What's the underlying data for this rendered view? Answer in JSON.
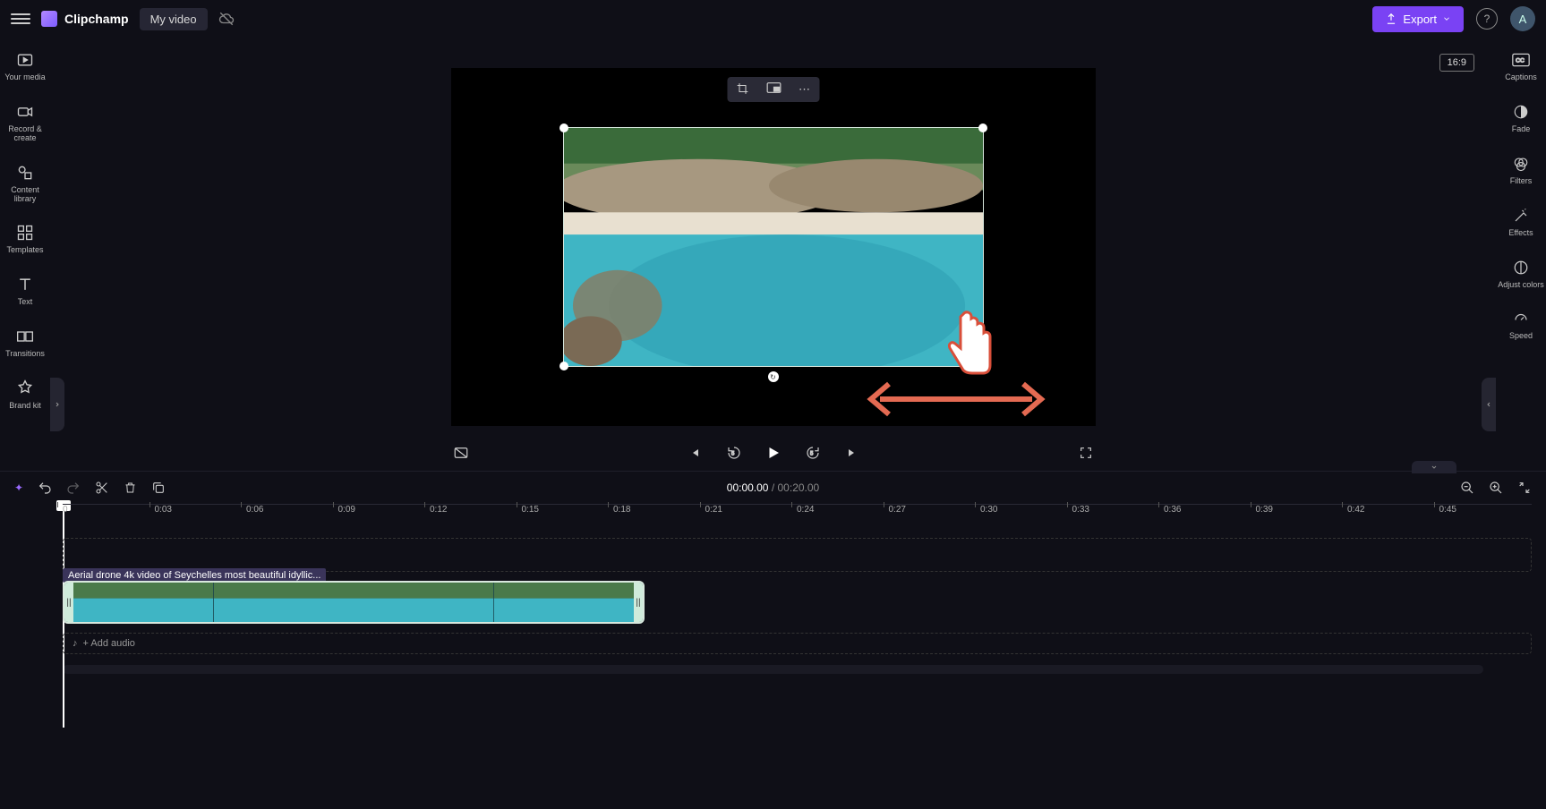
{
  "header": {
    "brand": "Clipchamp",
    "project_title": "My video",
    "export_label": "Export",
    "avatar_initial": "A"
  },
  "left_rail": [
    {
      "label": "Your media",
      "icon": "media"
    },
    {
      "label": "Record & create",
      "icon": "camera"
    },
    {
      "label": "Content library",
      "icon": "shapes"
    },
    {
      "label": "Templates",
      "icon": "templates"
    },
    {
      "label": "Text",
      "icon": "text"
    },
    {
      "label": "Transitions",
      "icon": "transitions"
    },
    {
      "label": "Brand kit",
      "icon": "brand"
    }
  ],
  "right_rail": [
    {
      "label": "Captions",
      "icon": "cc"
    },
    {
      "label": "Fade",
      "icon": "fade"
    },
    {
      "label": "Filters",
      "icon": "filters"
    },
    {
      "label": "Effects",
      "icon": "fx"
    },
    {
      "label": "Adjust colors",
      "icon": "adjust"
    },
    {
      "label": "Speed",
      "icon": "speed"
    }
  ],
  "stage": {
    "aspect_ratio": "16:9",
    "clip_toolbar": {
      "crop_icon": "crop",
      "pip_icon": "pip",
      "more_icon": "more"
    }
  },
  "playback": {
    "current_time": "00:00.00",
    "separator": " / ",
    "total_time": "00:20.00"
  },
  "ruler_ticks": [
    "0",
    "0:03",
    "0:06",
    "0:09",
    "0:12",
    "0:15",
    "0:18",
    "0:21",
    "0:24",
    "0:27",
    "0:30",
    "0:33",
    "0:36",
    "0:39",
    "0:42",
    "0:45"
  ],
  "timeline": {
    "clip_title": "Aerial drone 4k video of Seychelles most beautiful idyllic...",
    "add_audio_text": "+ Add audio"
  }
}
